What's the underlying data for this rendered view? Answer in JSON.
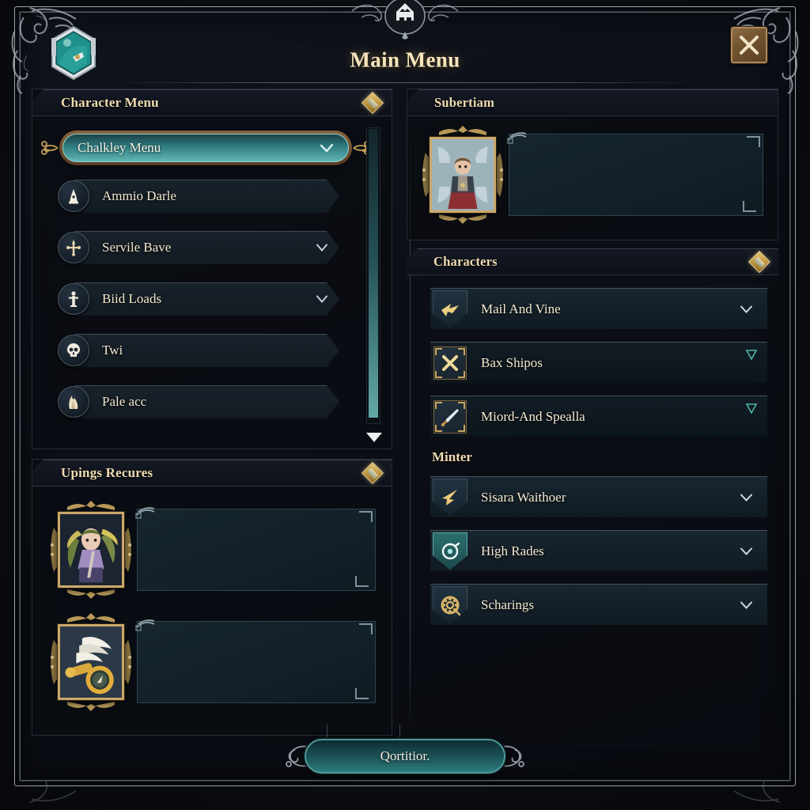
{
  "window": {
    "title": "Main Menu",
    "close_label": "X",
    "emblem_icon": "crest-emblem-icon",
    "badge_icon": "hex-badge-icon"
  },
  "colors": {
    "accent_teal": "#2f7d82",
    "accent_teal_light": "#62b6b4",
    "gold_text": "#f0dcb0",
    "bronze_frame": "#8a6440",
    "panel_bg": "#0d111a"
  },
  "left": {
    "character_panel": {
      "header": "Character Menu",
      "badge_icon": "gold-diamond-icon",
      "selected": {
        "label": "Chalkley Menu",
        "chevron_icon": "chevron-down-icon",
        "flourish_icon": "filigree-flourish-icon"
      },
      "items": [
        {
          "label": "Ammio Darle",
          "icon": "bell-tower-icon",
          "chevron": false
        },
        {
          "label": "Servile Bave",
          "icon": "ornate-cross-icon",
          "chevron": true
        },
        {
          "label": "Biid Loads",
          "icon": "statue-figure-icon",
          "chevron": true
        },
        {
          "label": "Twi",
          "icon": "skull-icon",
          "chevron": false
        },
        {
          "label": "Pale acc",
          "icon": "flame-claw-icon",
          "chevron": false
        }
      ],
      "scrollbar": {
        "arrow_icon": "triangle-down-icon"
      }
    },
    "recures_panel": {
      "header": "Upings Recures",
      "badge_icon": "gold-diamond-icon",
      "cards": [
        {
          "portrait_icon": "green-haired-girl-portrait",
          "plaque_text": ""
        },
        {
          "portrait_icon": "winged-gold-compass-icon",
          "plaque_text": ""
        }
      ]
    }
  },
  "right": {
    "subertiam_panel": {
      "header": "Subertiam",
      "card": {
        "portrait_icon": "red-skirt-character-portrait",
        "plaque_text": ""
      }
    },
    "characters_panel": {
      "header": "Characters",
      "badge_icon": "gold-diamond-icon",
      "items": [
        {
          "label": "Mail And Vine",
          "icon": "gold-bird-shield-icon",
          "chevron": true,
          "tag": false
        },
        {
          "label": "Bax Shipos",
          "icon": "crossed-swords-icon",
          "chevron": false,
          "tag": true
        },
        {
          "label": "Miord-And Spealla",
          "icon": "dagger-icon",
          "chevron": false,
          "tag": true
        }
      ],
      "subsection": {
        "header": "Minter",
        "items": [
          {
            "label": "Sisara Waithoer",
            "icon": "gold-arrow-shield-icon",
            "chevron": true,
            "highlight": false
          },
          {
            "label": "High Rades",
            "icon": "target-ring-icon",
            "chevron": true,
            "highlight": true
          },
          {
            "label": "Scharings",
            "icon": "gear-medallion-icon",
            "chevron": true,
            "highlight": false
          }
        ]
      }
    }
  },
  "footer": {
    "confirm_label": "Qortitior.",
    "ornament_icon": "filigree-ornament-icon"
  }
}
